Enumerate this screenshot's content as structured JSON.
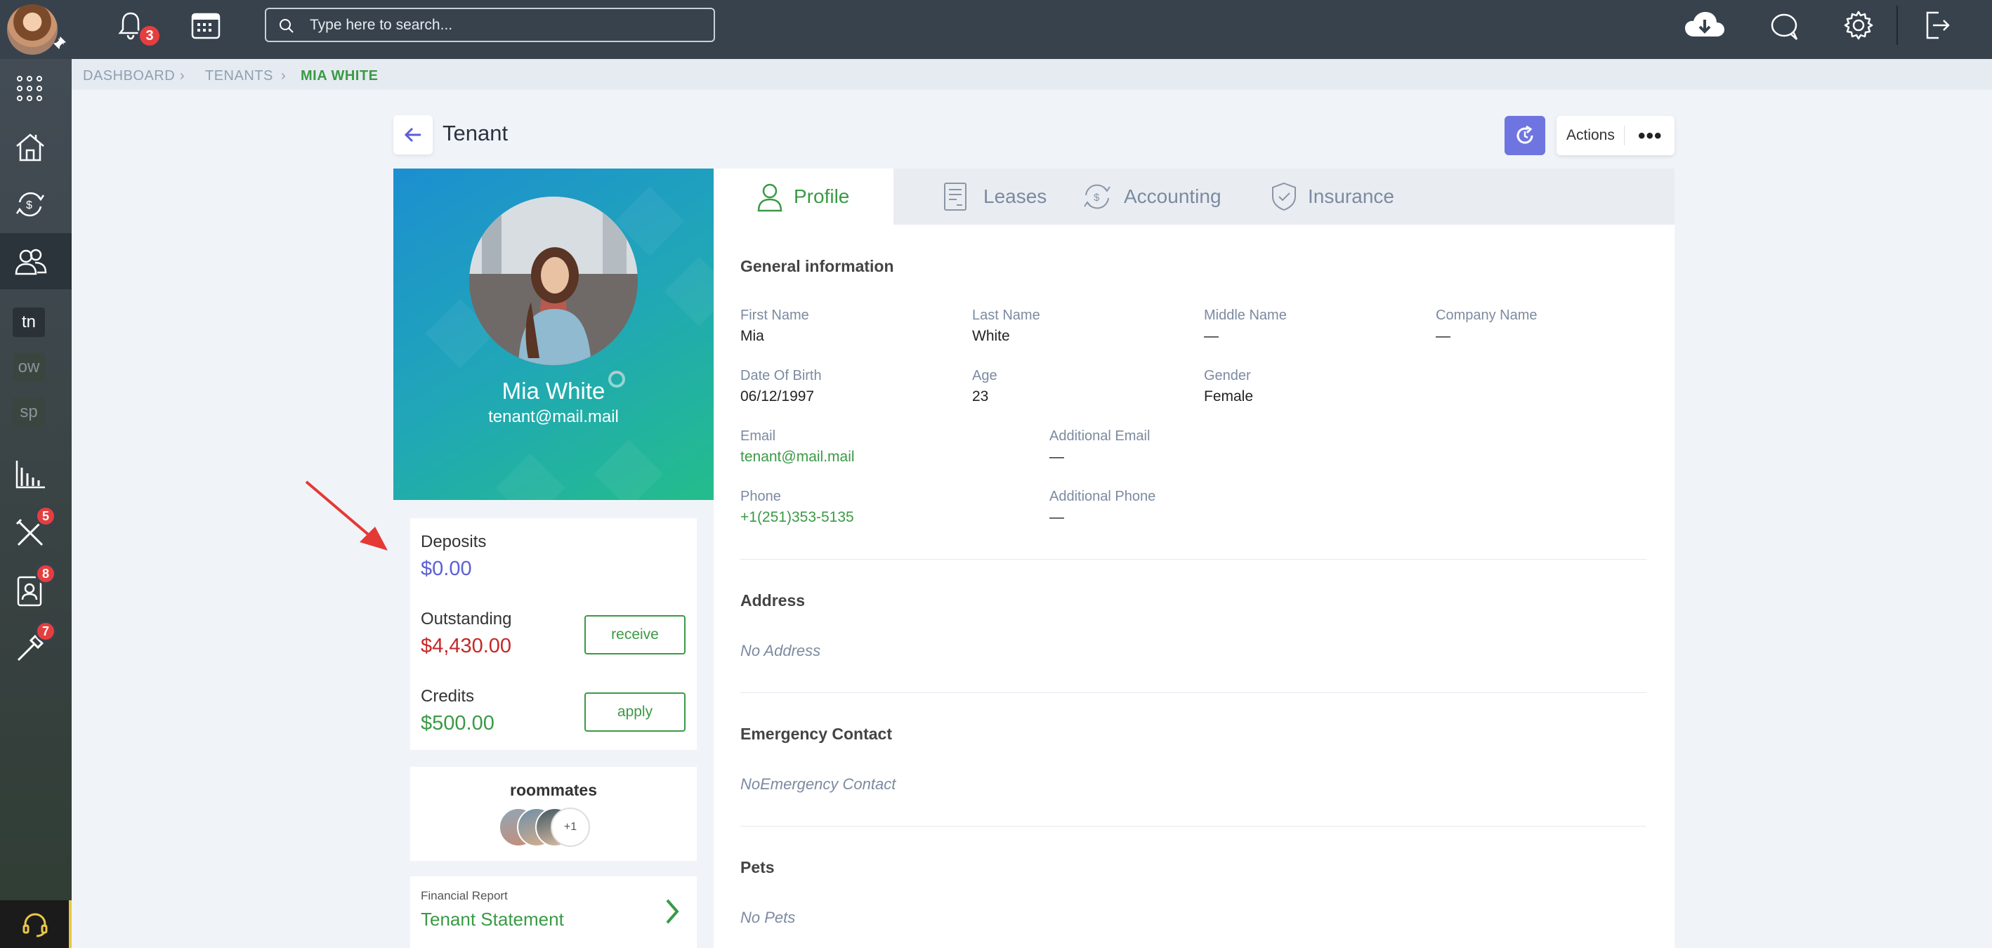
{
  "topbar": {
    "notifications_count": "3",
    "search_placeholder": "Type here to search..."
  },
  "sidebar": {
    "items": [
      {
        "icon": "apps-grid-icon"
      },
      {
        "icon": "properties-icon"
      },
      {
        "icon": "payments-icon"
      },
      {
        "icon": "tenants-icon"
      },
      {
        "label": "tn"
      },
      {
        "label": "ow"
      },
      {
        "label": "sp"
      },
      {
        "icon": "reports-icon"
      },
      {
        "icon": "maintenance-icon",
        "badge": "5"
      },
      {
        "icon": "applications-icon",
        "badge": "8"
      },
      {
        "icon": "tools-icon",
        "badge": "7"
      }
    ]
  },
  "breadcrumb": {
    "items": [
      "DASHBOARD",
      "TENANTS",
      "MIA WHITE"
    ]
  },
  "header": {
    "title": "Tenant",
    "actions_label": "Actions",
    "more_label": "•••"
  },
  "profile_card": {
    "name": "Mia White",
    "email": "tenant@mail.mail"
  },
  "finance": {
    "deposits_label": "Deposits",
    "deposits_value": "$0.00",
    "outstanding_label": "Outstanding",
    "outstanding_value": "$4,430.00",
    "receive_label": "receive",
    "credits_label": "Credits",
    "credits_value": "$500.00",
    "apply_label": "apply"
  },
  "roommates": {
    "title": "roommates",
    "more": "+1"
  },
  "report": {
    "small": "Financial Report",
    "title": "Tenant Statement"
  },
  "tabs": [
    "Profile",
    "Leases",
    "Accounting",
    "Insurance"
  ],
  "general": {
    "title": "General information",
    "first_name_label": "First Name",
    "first_name": "Mia",
    "last_name_label": "Last Name",
    "last_name": "White",
    "middle_name_label": "Middle Name",
    "middle_name": "—",
    "company_label": "Company Name",
    "company": "—",
    "dob_label": "Date Of Birth",
    "dob": "06/12/1997",
    "age_label": "Age",
    "age": "23",
    "gender_label": "Gender",
    "gender": "Female",
    "email_label": "Email",
    "email": "tenant@mail.mail",
    "add_email_label": "Additional Email",
    "add_email": "—",
    "phone_label": "Phone",
    "phone": "+1(251)353-5135",
    "add_phone_label": "Additional Phone",
    "add_phone": "—"
  },
  "address": {
    "title": "Address",
    "empty": "No Address"
  },
  "emergency": {
    "title": "Emergency Contact",
    "empty": "NoEmergency Contact"
  },
  "pets": {
    "title": "Pets",
    "empty": "No Pets"
  },
  "colors": {
    "accent_green": "#3a9a45",
    "outstanding_red": "#c62828",
    "deposits_blue": "#5b5fd6",
    "topbar": "#37424d"
  }
}
